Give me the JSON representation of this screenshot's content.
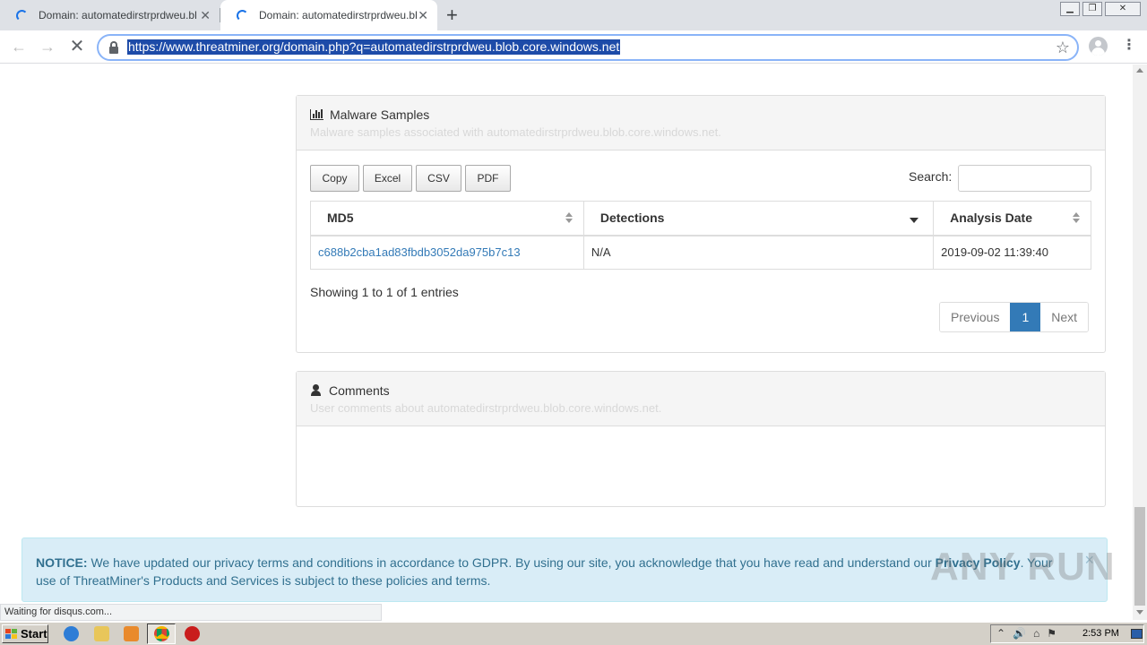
{
  "browser": {
    "tabs": [
      {
        "title": "Domain: automatedirstrprdweu.blob",
        "active": false
      },
      {
        "title": "Domain: automatedirstrprdweu.blob",
        "active": true
      }
    ],
    "close_glyph": "✕",
    "new_tab_glyph": "+",
    "url": "https://www.threatminer.org/domain.php?q=automatedirstrprdweu.blob.core.windows.net",
    "window_controls": {
      "minimize": "▁",
      "maximize": "❐",
      "close": "✕"
    },
    "nav": {
      "back": "←",
      "forward": "→",
      "stop": "✕"
    },
    "star_glyph": "☆",
    "menu_glyph": "⋮",
    "status_text": "Waiting for disqus.com..."
  },
  "malware_panel": {
    "title": "Malware Samples",
    "subtitle": "Malware samples associated with automatedirstrprdweu.blob.core.windows.net.",
    "export_buttons": [
      "Copy",
      "Excel",
      "CSV",
      "PDF"
    ],
    "search_label": "Search:",
    "search_value": "",
    "columns": [
      "MD5",
      "Detections",
      "Analysis Date"
    ],
    "rows": [
      {
        "md5": "c688b2cba1ad83fbdb3052da975b7c13",
        "detections": "N/A",
        "analysis_date": "2019-09-02 11:39:40"
      }
    ],
    "info": "Showing 1 to 1 of 1 entries",
    "pager": {
      "previous": "Previous",
      "current": "1",
      "next": "Next"
    }
  },
  "comments_panel": {
    "title": "Comments",
    "subtitle": "User comments about automatedirstrprdweu.blob.core.windows.net."
  },
  "notice": {
    "label": "NOTICE:",
    "text_before": " We have updated our privacy terms and conditions in accordance to GDPR. By using our site, you acknowledge that you have read and understand our ",
    "link": "Privacy Policy",
    "text_after": ". Your use of ThreatMiner's Products and Services is subject to these policies and terms.",
    "close_glyph": "×"
  },
  "watermark": "ANY RUN",
  "taskbar": {
    "start_label": "Start",
    "tray_glyphs": "⌃🔊⌂⚑",
    "clock": "2:53 PM"
  },
  "colors": {
    "accent": "#337ab7",
    "url_highlight": "#1d4ba8",
    "notice_bg": "#d9edf7",
    "notice_text": "#31708f"
  }
}
